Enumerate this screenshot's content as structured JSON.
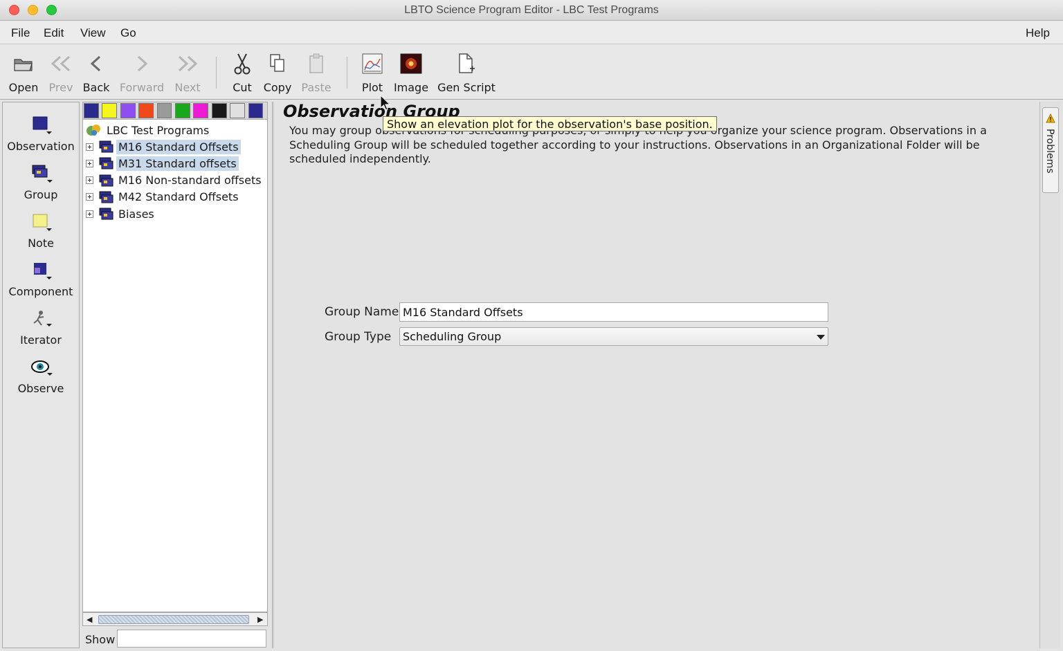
{
  "window": {
    "title": "LBTO Science Program Editor - LBC Test Programs"
  },
  "menubar": {
    "items": [
      "File",
      "Edit",
      "View",
      "Go"
    ],
    "help": "Help"
  },
  "toolbar": {
    "open": "Open",
    "prev": "Prev",
    "back": "Back",
    "forward": "Forward",
    "next": "Next",
    "cut": "Cut",
    "copy": "Copy",
    "paste": "Paste",
    "plot": "Plot",
    "image": "Image",
    "gen_script": "Gen Script"
  },
  "palette": {
    "items": [
      "Observation",
      "Group",
      "Note",
      "Component",
      "Iterator",
      "Observe"
    ]
  },
  "swatch_colors": [
    "#2a2a8c",
    "#f5f51e",
    "#8f4ff0",
    "#f04a1a",
    "#9a9a9a",
    "#1aa81a",
    "#f01ad6",
    "#1a1a1a",
    "#e0e0e0",
    "#2a2a8c"
  ],
  "tree": {
    "root": "LBC Test Programs",
    "items": [
      {
        "label": "M16 Standard Offsets",
        "selected": true
      },
      {
        "label": "M31 Standard offsets",
        "selected": true
      },
      {
        "label": "M16 Non-standard offsets",
        "selected": false
      },
      {
        "label": "M42 Standard Offsets",
        "selected": false
      },
      {
        "label": "Biases",
        "selected": false
      }
    ],
    "show_label": "Show",
    "show_value": ""
  },
  "main": {
    "title": "Observation Group",
    "description": "You may group observations for scheduling purposes, or simply to help you organize your science program. Observations in a Scheduling Group will be scheduled together according to your instructions. Observations in an Organizational Folder will be scheduled independently.",
    "group_name_label": "Group Name",
    "group_name_value": "M16 Standard Offsets",
    "group_type_label": "Group Type",
    "group_type_value": "Scheduling Group"
  },
  "problems": {
    "label": "Problems"
  },
  "tooltip": {
    "text": "Show an elevation plot for the observation's base position."
  }
}
